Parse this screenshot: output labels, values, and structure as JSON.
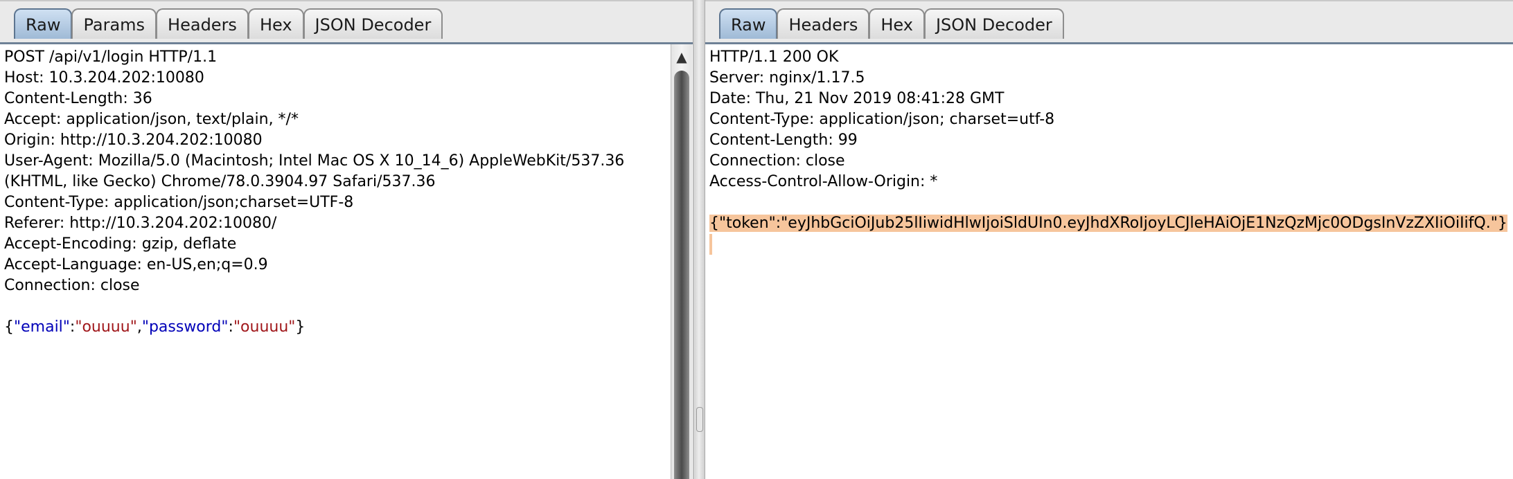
{
  "request": {
    "tabs": [
      "Raw",
      "Params",
      "Headers",
      "Hex",
      "JSON Decoder"
    ],
    "active_tab": "Raw",
    "lines": [
      "POST /api/v1/login HTTP/1.1",
      "Host: 10.3.204.202:10080",
      "Content-Length: 36",
      "Accept: application/json, text/plain, */*",
      "Origin: http://10.3.204.202:10080",
      "User-Agent: Mozilla/5.0 (Macintosh; Intel Mac OS X 10_14_6) AppleWebKit/537.36",
      "(KHTML, like Gecko) Chrome/78.0.3904.97 Safari/537.36",
      "Content-Type: application/json;charset=UTF-8",
      "Referer: http://10.3.204.202:10080/",
      "Accept-Encoding: gzip, deflate",
      "Accept-Language: en-US,en;q=0.9",
      "Connection: close"
    ],
    "body": {
      "open_brace": "{",
      "key1": "\"email\"",
      "colon1": ":",
      "value1": "\"ouuuu\"",
      "comma": ",",
      "key2": "\"password\"",
      "colon2": ":",
      "value2": "\"ouuuu\"",
      "close_brace": "}"
    }
  },
  "response": {
    "tabs": [
      "Raw",
      "Headers",
      "Hex",
      "JSON Decoder"
    ],
    "active_tab": "Raw",
    "lines": [
      "HTTP/1.1 200 OK",
      "Server: nginx/1.17.5",
      "Date: Thu, 21 Nov 2019 08:41:28 GMT",
      "Content-Type: application/json; charset=utf-8",
      "Content-Length: 99",
      "Connection: close",
      "Access-Control-Allow-Origin: *"
    ],
    "body": "{\"token\":\"eyJhbGciOiJub25lIiwidHlwIjoiSldUIn0.eyJhdXRoIjoyLCJleHAiOjE1NzQzMjc0ODgsInVzZXIiOiIifQ.\"}"
  },
  "scrollbar": {
    "arrow": "▲"
  },
  "colors": {
    "json_key": "#0000b8",
    "json_string": "#a0161a",
    "selection": "#f6c59c",
    "active_tab": "#a9c2dc"
  }
}
